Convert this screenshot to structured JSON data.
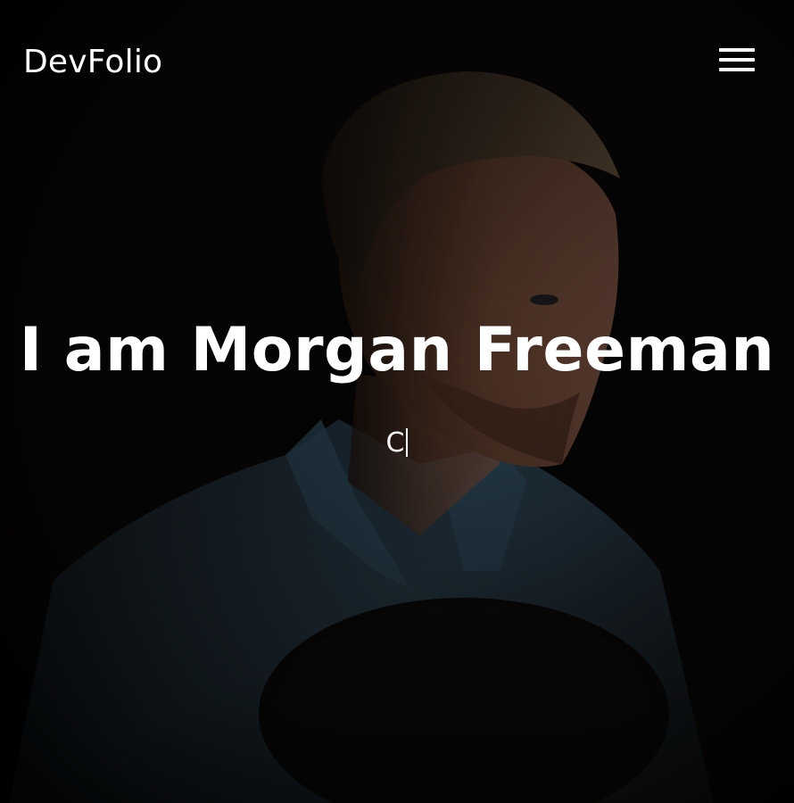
{
  "navbar": {
    "brand": "DevFolio",
    "menu_icon": "hamburger-menu-icon"
  },
  "hero": {
    "title": "I am Morgan Freeman",
    "typed_text": "C",
    "background_image": "portrait of man in denim shirt holding hat, dark background"
  },
  "colors": {
    "background": "#000000",
    "text": "#ffffff"
  }
}
